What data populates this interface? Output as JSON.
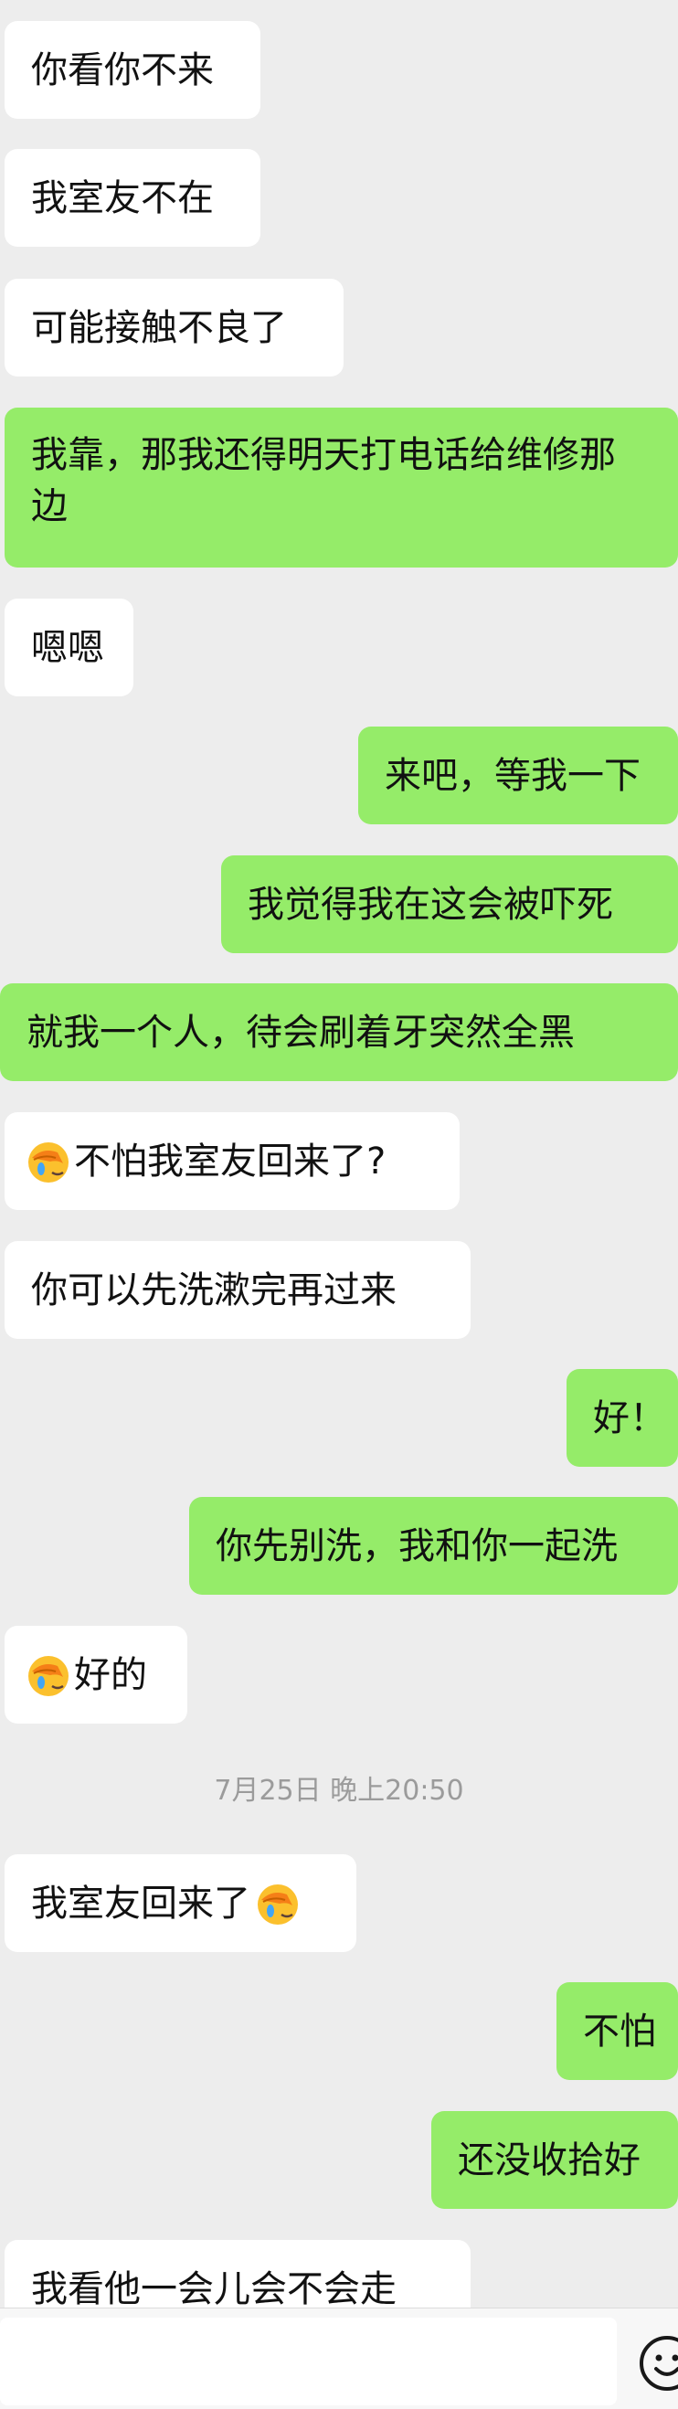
{
  "messages": [
    {
      "text": "你看你不来"
    },
    {
      "text": "我室友不在"
    },
    {
      "text": "可能接触不良了"
    },
    {
      "text": "我靠，那我还得明天打电话给维修那边"
    },
    {
      "text": "嗯嗯"
    },
    {
      "text": "来吧，等我一下"
    },
    {
      "text": "我觉得我在这会被吓死"
    },
    {
      "text": "就我一个人，待会刷着牙突然全黑"
    },
    {
      "text": "不怕我室友回来了?"
    },
    {
      "text": "你可以先洗漱完再过来"
    },
    {
      "text": "好！"
    },
    {
      "text": "你先别洗，我和你一起洗"
    },
    {
      "text": "好的"
    },
    {
      "text": "我室友回来了"
    },
    {
      "text": "不怕"
    },
    {
      "text": "还没收拾好"
    },
    {
      "text": "我看他一会儿会不会走"
    }
  ],
  "timestamp": "7月25日 晚上20:50",
  "icons": {
    "facepalm": "facepalm-emoji-icon",
    "smiley": "smiley-icon"
  },
  "colors": {
    "background": "#ededed",
    "incoming": "#ffffff",
    "outgoing": "#95ec69"
  }
}
